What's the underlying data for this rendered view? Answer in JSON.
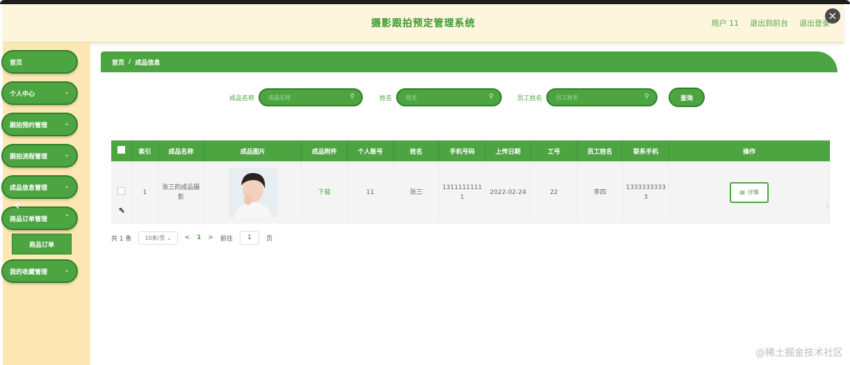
{
  "header": {
    "title": "摄影跟拍预定管理系统",
    "user": "用户 11",
    "to_front": "退出到前台",
    "logout": "退出登录",
    "close_icon": "×"
  },
  "sidebar": {
    "items": [
      {
        "label": "首页",
        "chevron": false
      },
      {
        "label": "个人中心",
        "chevron": true
      },
      {
        "label": "跟拍预约管理",
        "chevron": true
      },
      {
        "label": "跟拍流程管理",
        "chevron": true
      },
      {
        "label": "成品信息管理",
        "chevron": true
      },
      {
        "label": "商品订单管理",
        "chevron": true
      },
      {
        "label": "我的收藏管理",
        "chevron": true
      }
    ],
    "submenu": "商品订单"
  },
  "breadcrumb": {
    "home": "首页",
    "sep": "/",
    "current": "成品信息"
  },
  "search": {
    "f1_label": "成品名称",
    "f1_placeholder": "成品名称",
    "f2_label": "姓名",
    "f2_placeholder": "姓名",
    "f3_label": "员工姓名",
    "f3_placeholder": "员工姓名",
    "button": "查询"
  },
  "table": {
    "headers": [
      "",
      "索引",
      "成品名称",
      "成品图片",
      "成品附件",
      "个人账号",
      "姓名",
      "手机号码",
      "上传日期",
      "工号",
      "员工姓名",
      "联系手机",
      "操作"
    ],
    "row": {
      "index": "1",
      "name": "张三的成品摄影",
      "attachment": "下载",
      "account": "11",
      "person": "张三",
      "phone": "13111111111",
      "date": "2022-02-24",
      "emp_no": "22",
      "emp_name": "李四",
      "contact": "13333333333",
      "action": "详情"
    }
  },
  "pager": {
    "total": "共 1 条",
    "page_size": "10条/页",
    "prev": "<",
    "current": "1",
    "next": ">",
    "goto": "前往",
    "goto_value": "1",
    "page_unit": "页"
  },
  "watermark": "@稀土掘金技术社区"
}
